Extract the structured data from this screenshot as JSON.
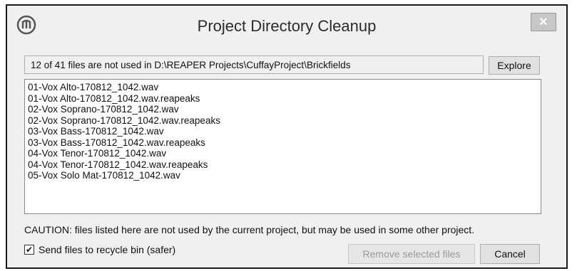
{
  "window": {
    "title": "Project Directory Cleanup",
    "close_label": "×"
  },
  "path_info": "12 of 41 files are not used in D:\\REAPER Projects\\CuffayProject\\Brickfields",
  "explore_label": "Explore",
  "files": [
    "01-Vox Alto-170812_1042.wav",
    "01-Vox Alto-170812_1042.wav.reapeaks",
    "02-Vox Soprano-170812_1042.wav",
    "02-Vox Soprano-170812_1042.wav.reapeaks",
    "03-Vox Bass-170812_1042.wav",
    "03-Vox Bass-170812_1042.wav.reapeaks",
    "04-Vox Tenor-170812_1042.wav",
    "04-Vox Tenor-170812_1042.wav.reapeaks",
    "05-Vox Solo Mat-170812_1042.wav"
  ],
  "caution_text": "CAUTION: files listed here are not used by the current project, but may be used in some other project.",
  "recycle": {
    "label": "Send files to recycle bin (safer)",
    "checked": true,
    "check_glyph": "✔"
  },
  "remove_label": "Remove selected files",
  "cancel_label": "Cancel"
}
